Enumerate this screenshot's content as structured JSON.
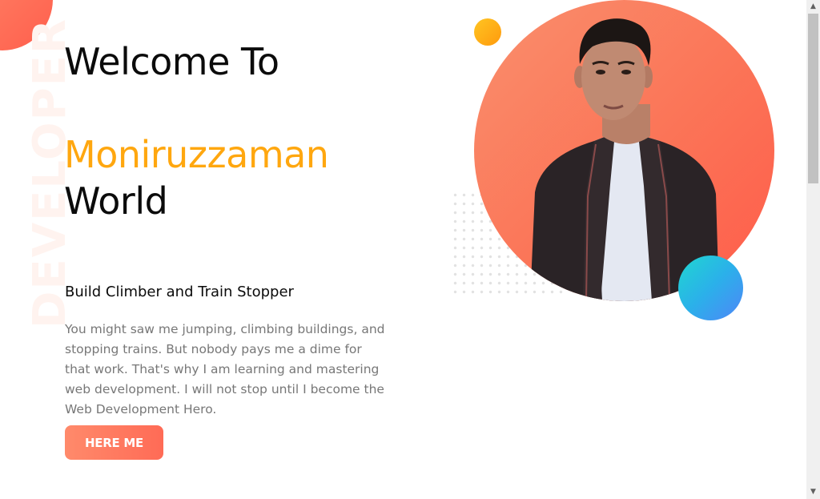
{
  "hero": {
    "vertical_word": "DEVELOPER",
    "title_line1": "Welcome To",
    "title_name": "Moniruzzaman",
    "title_line3": "World",
    "subtitle": "Build Climber and Train Stopper",
    "description": "You might saw me jumping, climbing buildings, and stopping trains. But nobody pays me a dime for that work. That's why I am learning and mastering web development. I will not stop until I become the Web Development Hero.",
    "cta_label": "HERE ME"
  },
  "colors": {
    "accent_orange": "#ffa70f",
    "coral": "#ff7a5c",
    "teal": "#2bb0ea"
  },
  "icons": {
    "scroll_up": "▲",
    "scroll_down": "▼"
  }
}
